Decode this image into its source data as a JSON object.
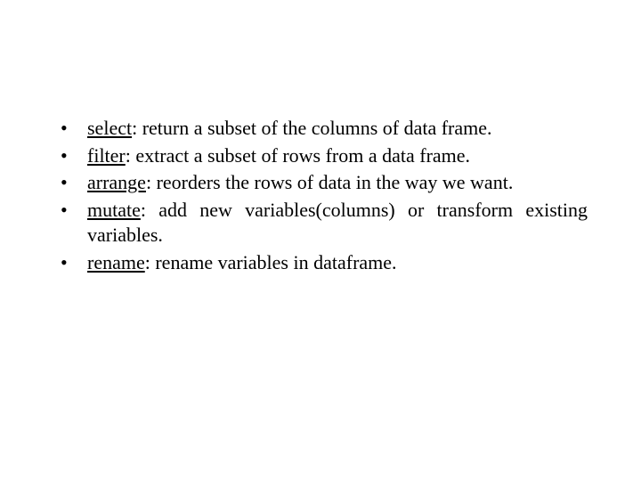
{
  "items": [
    {
      "term": "select",
      "desc": ": return a subset of the columns of data frame."
    },
    {
      "term": "filter",
      "desc": ": extract a subset of rows from a data frame."
    },
    {
      "term": "arrange",
      "desc": ": reorders the rows of data in the way we want."
    },
    {
      "term": "mutate",
      "desc": ": add new variables(columns) or transform existing variables."
    },
    {
      "term": "rename",
      "desc": ": rename variables in dataframe."
    }
  ]
}
